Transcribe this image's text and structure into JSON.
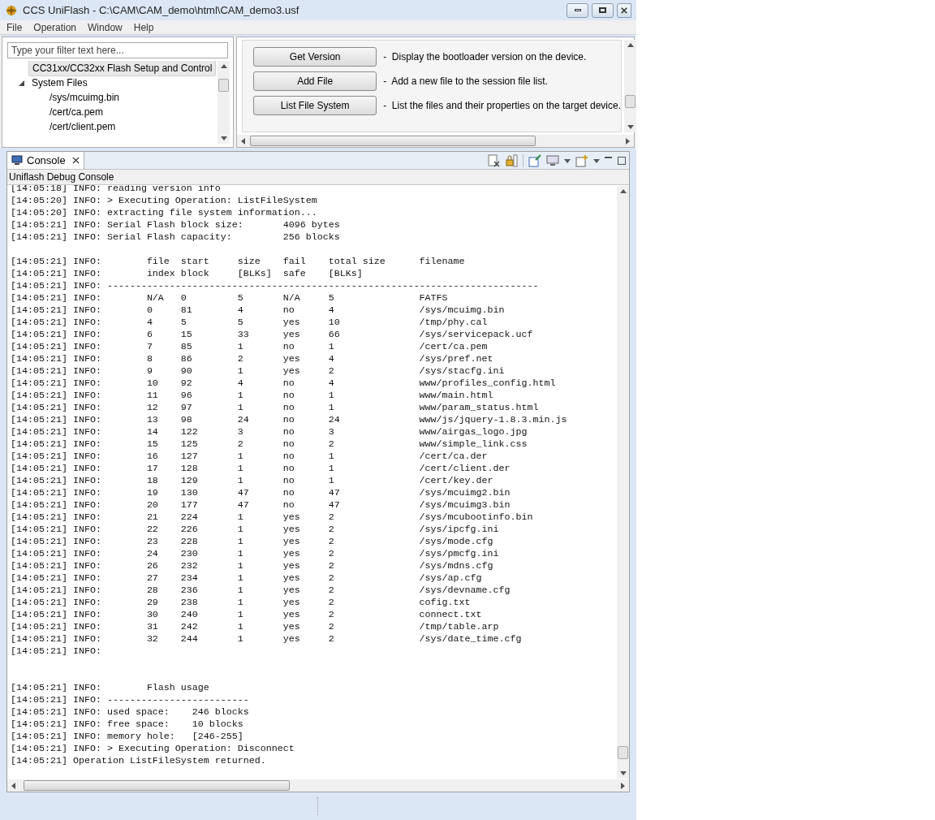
{
  "window": {
    "title": "CCS UniFlash - C:\\CAM\\CAM_demo\\html\\CAM_demo3.usf"
  },
  "menu": [
    "File",
    "Operation",
    "Window",
    "Help"
  ],
  "filter": {
    "placeholder": "Type your filter text here..."
  },
  "tree": [
    {
      "label": "CC31xx/CC32xx Flash Setup and Control",
      "selected": true
    },
    {
      "label": "System Files",
      "selected": false,
      "expanded": true,
      "children": [
        {
          "label": "/sys/mcuimg.bin",
          "selected": false
        },
        {
          "label": "/cert/ca.pem",
          "selected": false
        },
        {
          "label": "/cert/client.pem",
          "selected": false
        }
      ]
    }
  ],
  "operations": [
    {
      "button": "Get Version",
      "description": "-  Display the bootloader version on the device."
    },
    {
      "button": "Add File",
      "description": "-  Add a new file to the session file list."
    },
    {
      "button": "List File System",
      "description": "-  List the files and their properties on the target device."
    }
  ],
  "console_tab": {
    "label": "Console"
  },
  "console_title": "Uniflash Debug Console",
  "console_lines": [
    {
      "kind": "text",
      "text": "[14:05:18] INFO: reading version info"
    },
    {
      "kind": "text",
      "text": "[14:05:20] INFO: > Executing Operation: ListFileSystem"
    },
    {
      "kind": "text",
      "text": "[14:05:20] INFO: extracting file system information..."
    },
    {
      "kind": "text",
      "text": "[14:05:21] INFO: Serial Flash block size:       4096 bytes"
    },
    {
      "kind": "text",
      "text": "[14:05:21] INFO: Serial Flash capacity:         256 blocks"
    },
    {
      "kind": "blank"
    },
    {
      "kind": "row",
      "prefix": "[14:05:21] INFO:",
      "cells": [
        "file",
        "start",
        "size",
        "fail",
        "total size",
        "filename"
      ]
    },
    {
      "kind": "row",
      "prefix": "[14:05:21] INFO:",
      "cells": [
        "index",
        "block",
        "[BLKs]",
        "safe",
        "[BLKs]"
      ]
    },
    {
      "kind": "text",
      "text": "[14:05:21] INFO: ----------------------------------------------------------------------------"
    },
    {
      "kind": "row",
      "prefix": "[14:05:21] INFO:",
      "cells": [
        "N/A",
        "0",
        "5",
        "N/A",
        "5",
        "FATFS"
      ]
    },
    {
      "kind": "row",
      "prefix": "[14:05:21] INFO:",
      "cells": [
        "0",
        "81",
        "4",
        "no",
        "4",
        "/sys/mcuimg.bin"
      ]
    },
    {
      "kind": "row",
      "prefix": "[14:05:21] INFO:",
      "cells": [
        "4",
        "5",
        "5",
        "yes",
        "10",
        "/tmp/phy.cal"
      ]
    },
    {
      "kind": "row",
      "prefix": "[14:05:21] INFO:",
      "cells": [
        "6",
        "15",
        "33",
        "yes",
        "66",
        "/sys/servicepack.ucf"
      ]
    },
    {
      "kind": "row",
      "prefix": "[14:05:21] INFO:",
      "cells": [
        "7",
        "85",
        "1",
        "no",
        "1",
        "/cert/ca.pem"
      ]
    },
    {
      "kind": "row",
      "prefix": "[14:05:21] INFO:",
      "cells": [
        "8",
        "86",
        "2",
        "yes",
        "4",
        "/sys/pref.net"
      ]
    },
    {
      "kind": "row",
      "prefix": "[14:05:21] INFO:",
      "cells": [
        "9",
        "90",
        "1",
        "yes",
        "2",
        "/sys/stacfg.ini"
      ]
    },
    {
      "kind": "row",
      "prefix": "[14:05:21] INFO:",
      "cells": [
        "10",
        "92",
        "4",
        "no",
        "4",
        "www/profiles_config.html"
      ]
    },
    {
      "kind": "row",
      "prefix": "[14:05:21] INFO:",
      "cells": [
        "11",
        "96",
        "1",
        "no",
        "1",
        "www/main.html"
      ]
    },
    {
      "kind": "row",
      "prefix": "[14:05:21] INFO:",
      "cells": [
        "12",
        "97",
        "1",
        "no",
        "1",
        "www/param_status.html"
      ]
    },
    {
      "kind": "row",
      "prefix": "[14:05:21] INFO:",
      "cells": [
        "13",
        "98",
        "24",
        "no",
        "24",
        "www/js/jquery-1.8.3.min.js"
      ]
    },
    {
      "kind": "row",
      "prefix": "[14:05:21] INFO:",
      "cells": [
        "14",
        "122",
        "3",
        "no",
        "3",
        "www/airgas_logo.jpg"
      ]
    },
    {
      "kind": "row",
      "prefix": "[14:05:21] INFO:",
      "cells": [
        "15",
        "125",
        "2",
        "no",
        "2",
        "www/simple_link.css"
      ]
    },
    {
      "kind": "row",
      "prefix": "[14:05:21] INFO:",
      "cells": [
        "16",
        "127",
        "1",
        "no",
        "1",
        "/cert/ca.der"
      ]
    },
    {
      "kind": "row",
      "prefix": "[14:05:21] INFO:",
      "cells": [
        "17",
        "128",
        "1",
        "no",
        "1",
        "/cert/client.der"
      ]
    },
    {
      "kind": "row",
      "prefix": "[14:05:21] INFO:",
      "cells": [
        "18",
        "129",
        "1",
        "no",
        "1",
        "/cert/key.der"
      ]
    },
    {
      "kind": "row",
      "prefix": "[14:05:21] INFO:",
      "cells": [
        "19",
        "130",
        "47",
        "no",
        "47",
        "/sys/mcuimg2.bin"
      ]
    },
    {
      "kind": "row",
      "prefix": "[14:05:21] INFO:",
      "cells": [
        "20",
        "177",
        "47",
        "no",
        "47",
        "/sys/mcuimg3.bin"
      ]
    },
    {
      "kind": "row",
      "prefix": "[14:05:21] INFO:",
      "cells": [
        "21",
        "224",
        "1",
        "yes",
        "2",
        "/sys/mcubootinfo.bin"
      ]
    },
    {
      "kind": "row",
      "prefix": "[14:05:21] INFO:",
      "cells": [
        "22",
        "226",
        "1",
        "yes",
        "2",
        "/sys/ipcfg.ini"
      ]
    },
    {
      "kind": "row",
      "prefix": "[14:05:21] INFO:",
      "cells": [
        "23",
        "228",
        "1",
        "yes",
        "2",
        "/sys/mode.cfg"
      ]
    },
    {
      "kind": "row",
      "prefix": "[14:05:21] INFO:",
      "cells": [
        "24",
        "230",
        "1",
        "yes",
        "2",
        "/sys/pmcfg.ini"
      ]
    },
    {
      "kind": "row",
      "prefix": "[14:05:21] INFO:",
      "cells": [
        "26",
        "232",
        "1",
        "yes",
        "2",
        "/sys/mdns.cfg"
      ]
    },
    {
      "kind": "row",
      "prefix": "[14:05:21] INFO:",
      "cells": [
        "27",
        "234",
        "1",
        "yes",
        "2",
        "/sys/ap.cfg"
      ]
    },
    {
      "kind": "row",
      "prefix": "[14:05:21] INFO:",
      "cells": [
        "28",
        "236",
        "1",
        "yes",
        "2",
        "/sys/devname.cfg"
      ]
    },
    {
      "kind": "row",
      "prefix": "[14:05:21] INFO:",
      "cells": [
        "29",
        "238",
        "1",
        "yes",
        "2",
        "cofig.txt"
      ]
    },
    {
      "kind": "row",
      "prefix": "[14:05:21] INFO:",
      "cells": [
        "30",
        "240",
        "1",
        "yes",
        "2",
        "connect.txt"
      ]
    },
    {
      "kind": "row",
      "prefix": "[14:05:21] INFO:",
      "cells": [
        "31",
        "242",
        "1",
        "yes",
        "2",
        "/tmp/table.arp"
      ]
    },
    {
      "kind": "row",
      "prefix": "[14:05:21] INFO:",
      "cells": [
        "32",
        "244",
        "1",
        "yes",
        "2",
        "/sys/date_time.cfg"
      ]
    },
    {
      "kind": "text",
      "text": "[14:05:21] INFO:"
    },
    {
      "kind": "blank"
    },
    {
      "kind": "blank"
    },
    {
      "kind": "text",
      "text": "[14:05:21] INFO:        Flash usage"
    },
    {
      "kind": "text",
      "text": "[14:05:21] INFO: -------------------------"
    },
    {
      "kind": "text",
      "text": "[14:05:21] INFO: used space:    246 blocks"
    },
    {
      "kind": "text",
      "text": "[14:05:21] INFO: free space:    10 blocks"
    },
    {
      "kind": "text",
      "text": "[14:05:21] INFO: memory hole:   [246-255]"
    },
    {
      "kind": "text",
      "text": "[14:05:21] INFO: > Executing Operation: Disconnect"
    },
    {
      "kind": "text",
      "text": "[14:05:21] Operation ListFileSystem returned."
    }
  ]
}
